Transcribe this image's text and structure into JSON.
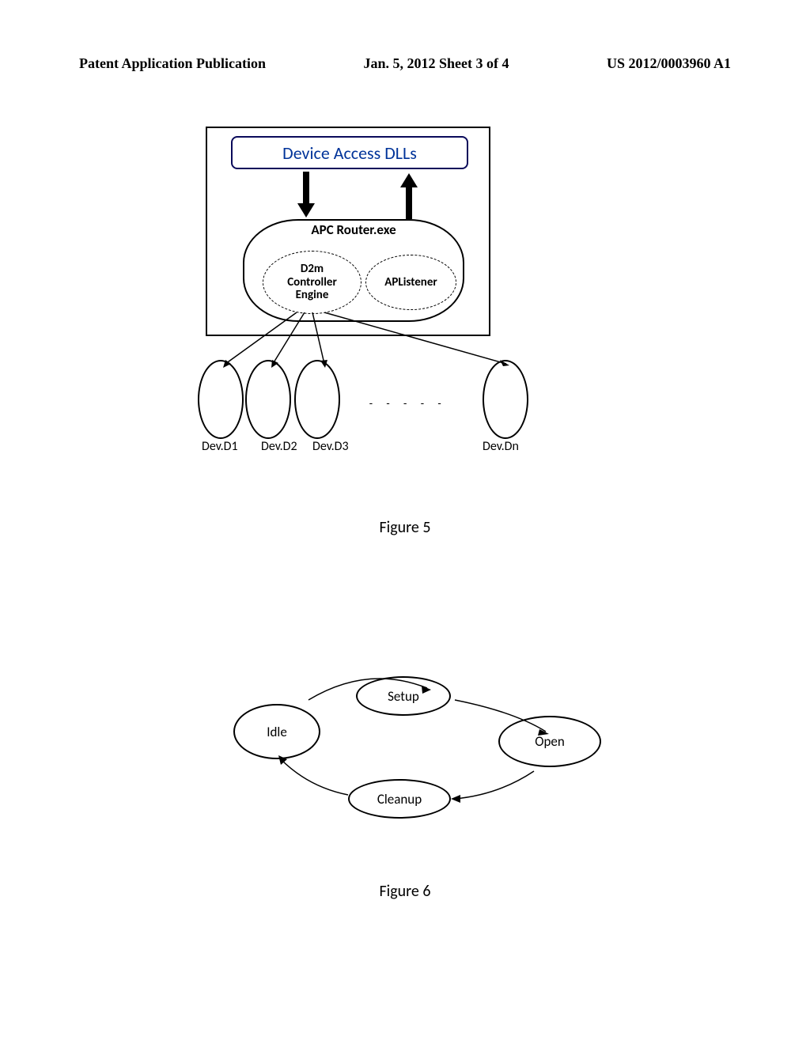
{
  "header": {
    "left": "Patent Application Publication",
    "center": "Jan. 5, 2012  Sheet 3 of 4",
    "right": "US 2012/0003960 A1"
  },
  "figure5": {
    "device_access": "Device Access DLLs",
    "router_title": "APC Router.exe",
    "d2m_line1": "D2m",
    "d2m_line2": "Controller",
    "d2m_line3": "Engine",
    "aplistener": "APListener",
    "dev1": "Dev.D1",
    "dev2": "Dev.D2",
    "dev3": "Dev.D3",
    "devn": "Dev.Dn",
    "caption": "Figure 5"
  },
  "figure6": {
    "idle": "Idle",
    "setup": "Setup",
    "open": "Open",
    "cleanup": "Cleanup",
    "caption": "Figure 6"
  }
}
